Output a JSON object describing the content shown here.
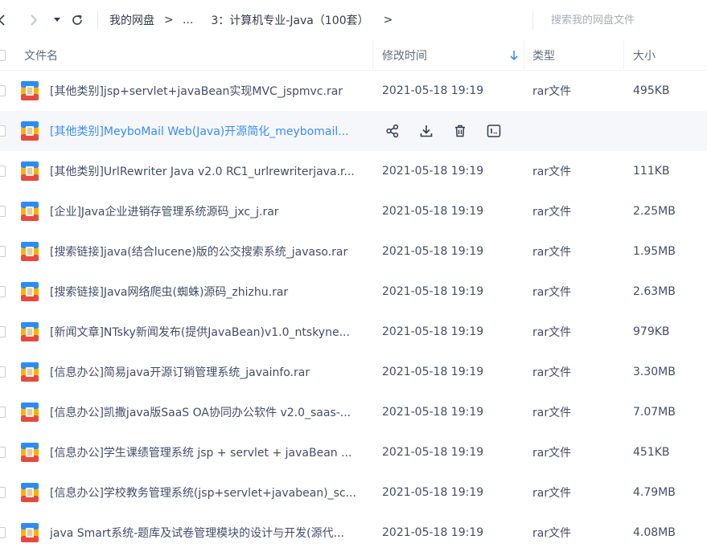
{
  "nav": {
    "breadcrumb_root": "我的网盘",
    "breadcrumb_ellipsis": "...",
    "breadcrumb_current": "3：计算机专业-Java（100套）",
    "separator": ">"
  },
  "search": {
    "placeholder": "搜索我的网盘文件"
  },
  "columns": {
    "name": "文件名",
    "modified": "修改时间",
    "type": "类型",
    "size": "大小"
  },
  "colors": {
    "accent": "#3b8cff",
    "hover_row": "#f5f7fb",
    "text": "#424e67"
  },
  "icons": {
    "file": "rar-file-icon",
    "share": "share-icon",
    "download": "download-icon",
    "delete": "trash-icon",
    "more": "more-icon"
  },
  "files": [
    {
      "name": "[其他类别]jsp+servlet+javaBean实现MVC_jspmvc.rar",
      "modified": "2021-05-18 19:19",
      "type": "rar文件",
      "size": "495KB"
    },
    {
      "name": "[其他类别]MeyboMail Web(Java)开源简化_meybomail...",
      "modified": "",
      "type": "",
      "size": ""
    },
    {
      "name": "[其他类别]UrlRewriter Java v2.0 RC1_urlrewriterjava.r...",
      "modified": "2021-05-18 19:19",
      "type": "rar文件",
      "size": "111KB"
    },
    {
      "name": "[企业]Java企业进销存管理系统源码_jxc_j.rar",
      "modified": "2021-05-18 19:19",
      "type": "rar文件",
      "size": "2.25MB"
    },
    {
      "name": "[搜索链接]java(结合lucene)版的公交搜索系统_javaso.rar",
      "modified": "2021-05-18 19:19",
      "type": "rar文件",
      "size": "1.95MB"
    },
    {
      "name": "[搜索链接]Java网络爬虫(蜘蛛)源码_zhizhu.rar",
      "modified": "2021-05-18 19:19",
      "type": "rar文件",
      "size": "2.63MB"
    },
    {
      "name": "[新闻文章]NTsky新闻发布(提供JavaBean)v1.0_ntskyne...",
      "modified": "2021-05-18 19:19",
      "type": "rar文件",
      "size": "979KB"
    },
    {
      "name": "[信息办公]简易java开源订销管理系统_javainfo.rar",
      "modified": "2021-05-18 19:19",
      "type": "rar文件",
      "size": "3.30MB"
    },
    {
      "name": "[信息办公]凯撒java版SaaS OA协同办公软件 v2.0_saas-...",
      "modified": "2021-05-18 19:19",
      "type": "rar文件",
      "size": "7.07MB"
    },
    {
      "name": "[信息办公]学生课绩管理系统 jsp + servlet + javaBean ...",
      "modified": "2021-05-18 19:19",
      "type": "rar文件",
      "size": "451KB"
    },
    {
      "name": "[信息办公]学校教务管理系统(jsp+servlet+javabean)_sc...",
      "modified": "2021-05-18 19:19",
      "type": "rar文件",
      "size": "4.79MB"
    },
    {
      "name": "java Smart系统-题库及试卷管理模块的设计与开发(源代...",
      "modified": "2021-05-18 19:19",
      "type": "rar文件",
      "size": "4.08MB"
    }
  ]
}
